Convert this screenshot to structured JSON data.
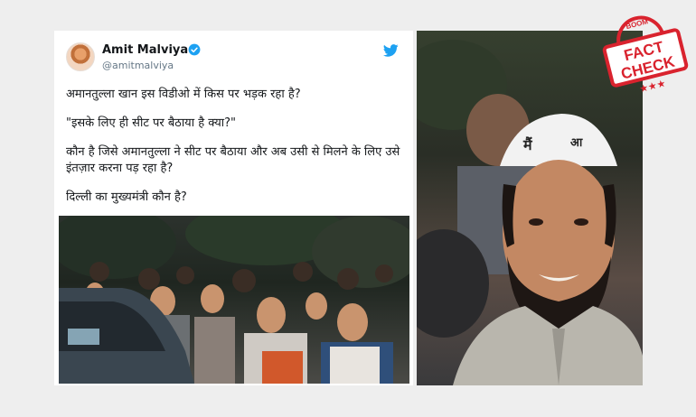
{
  "tweet": {
    "author_name": "Amit Malviya",
    "author_handle": "@amitmalviya",
    "paragraphs": [
      "अमानतुल्ला खान इस विडीओ में किस पर भड़क रहा है?",
      "\"इसके लिए ही सीट पर बैठाया है क्या?\"",
      "कौन है जिसे अमानतुल्ला ने सीट पर बैठाया और अब उसी से मिलने के लिए उसे इंतज़ार करना पड़ रहा है?",
      "दिल्ली का मुख्यमंत्री कौन है?"
    ],
    "icons": {
      "verified": "verified-badge-icon",
      "brand": "twitter-bird-icon"
    }
  },
  "stamp": {
    "top_text": "BOOM",
    "line1": "FACT",
    "line2": "CHECK",
    "color": "#d9232e"
  },
  "colors": {
    "twitter_blue": "#1da1f2",
    "page_bg": "#eeeeee"
  }
}
